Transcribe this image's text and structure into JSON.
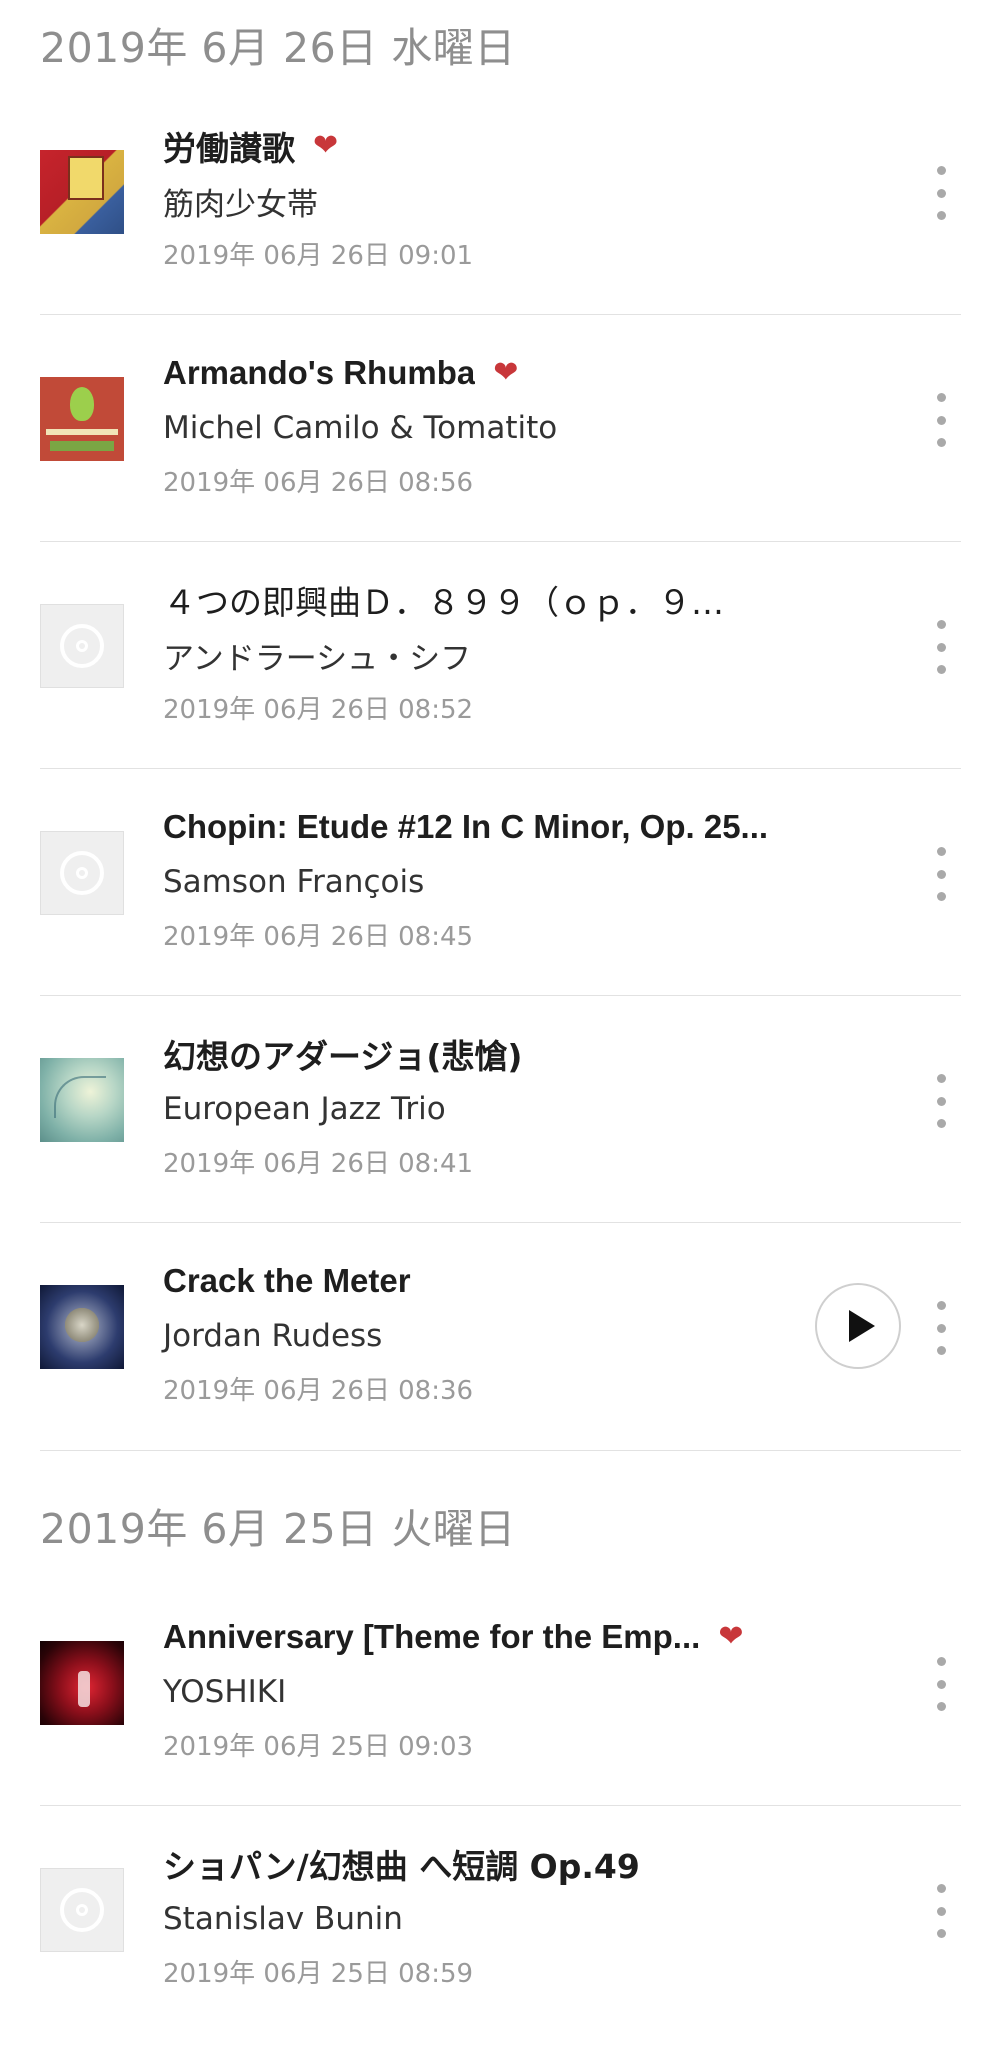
{
  "sections": [
    {
      "date": "2019年 6月 26日 水曜日",
      "items": [
        {
          "title": "労働讃歌",
          "favorite": true,
          "artist": "筋肉少女帯",
          "timestamp": "2019年 06月 26日 09:01",
          "art": "album-art"
        },
        {
          "title": "Armando's Rhumba",
          "favorite": true,
          "artist": "Michel Camilo & Tomatito",
          "timestamp": "2019年 06月 26日 08:56",
          "art": "album-art"
        },
        {
          "title": "４つの即興曲Ｄ．８９９（ｏｐ．９…",
          "favorite": false,
          "artist": "アンドラーシュ・シフ",
          "timestamp": "2019年 06月 26日 08:52",
          "art": "placeholder-disc"
        },
        {
          "title": "Chopin: Etude #12 In C Minor, Op. 25...",
          "favorite": false,
          "artist": "Samson François",
          "timestamp": "2019年 06月 26日 08:45",
          "art": "placeholder-disc"
        },
        {
          "title": "幻想のアダージョ(悲愴)",
          "favorite": false,
          "artist": "European Jazz Trio",
          "timestamp": "2019年 06月 26日 08:41",
          "art": "album-art"
        },
        {
          "title": "Crack the Meter",
          "favorite": false,
          "artist": "Jordan Rudess",
          "timestamp": "2019年 06月 26日 08:36",
          "art": "album-art",
          "has_play_button": true
        }
      ]
    },
    {
      "date": "2019年 6月 25日 火曜日",
      "items": [
        {
          "title": "Anniversary [Theme for the Emp...",
          "favorite": true,
          "artist": "YOSHIKI",
          "timestamp": "2019年 06月 25日 09:03",
          "art": "album-art"
        },
        {
          "title": "ショパン/幻想曲 へ短調 Op.49",
          "favorite": false,
          "artist": "Stanislav Bunin",
          "timestamp": "2019年 06月 25日 08:59",
          "art": "placeholder-disc"
        }
      ]
    }
  ],
  "icons": {
    "favorite": "heart-icon",
    "more": "more-vertical-icon",
    "play": "play-icon",
    "placeholder": "disc-icon"
  },
  "colors": {
    "heart": "#c8373a",
    "date_header": "#8e8e8e",
    "timestamp": "#9a9a9a",
    "divider": "#e2e2e2",
    "more_dots": "#a9a9a9"
  }
}
